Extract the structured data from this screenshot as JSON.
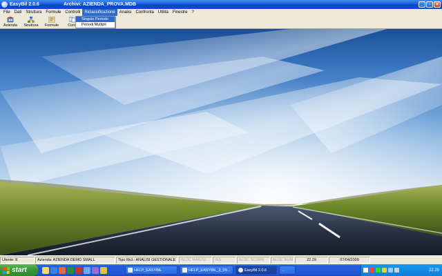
{
  "window": {
    "app_title": "EasyBil   2.0.6",
    "archive_title": "Archivi: AZIENDA_PROVA.MDB"
  },
  "menu": {
    "items": [
      "File",
      "Dati",
      "Struttura",
      "Formule",
      "Controlli",
      "Riclassificazione",
      "Analisi",
      "Confronta",
      "Utilità",
      "Finestre",
      "?"
    ],
    "active": "Riclassificazione"
  },
  "dropdown": {
    "items": [
      "Singolo Periodo",
      "Periodi Multipli"
    ],
    "selected": "Singolo Periodo"
  },
  "toolbar": {
    "buttons": [
      {
        "label": "Azienda",
        "icon": "building-icon"
      },
      {
        "label": "Struttura",
        "icon": "structure-icon"
      },
      {
        "label": "Formule",
        "icon": "formula-icon"
      },
      {
        "label": "Confr",
        "icon": "compare-icon"
      }
    ]
  },
  "status": {
    "utente": "Utente: E",
    "azienda": "Azienda: AZIENDA DEMO SMALL",
    "tipo": "Tipo Ricl.: ANALISI GESTIONALE",
    "maiusc": "BLOC MAIUSC",
    "ins": "INS",
    "scorr": "BLOC SCORR",
    "num": "BLOC NUM",
    "time": "22.29",
    "date": "07/04/2009"
  },
  "taskbar": {
    "start_label": "start",
    "tasks": [
      "HELP_EASYBIL",
      "HELP_EASYBIL_3_09...",
      "EasyBil   2.0.6",
      "..."
    ],
    "clock": "22.29"
  },
  "colors": {
    "titlebar": "#0a46c4",
    "menu_highlight": "#316ac5",
    "taskbar": "#245edb",
    "start": "#3c9a38"
  }
}
